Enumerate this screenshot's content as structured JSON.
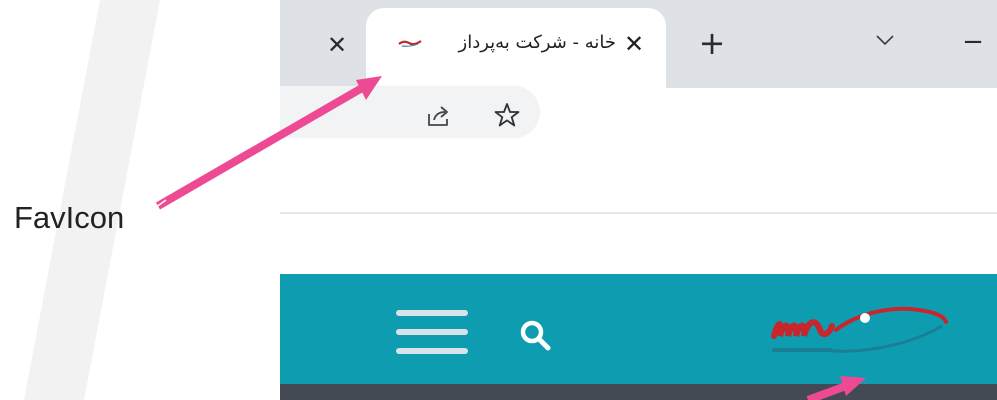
{
  "browser": {
    "prev_tab_close_glyph": "✕",
    "active_tab": {
      "title": "خانه - شرکت به‌پرداز",
      "favicon": "site-favicon",
      "close_glyph": "✕"
    },
    "new_tab_glyph": "+",
    "tab_search_icon": "chevron-down-icon",
    "minimize_glyph": "−",
    "toolbar": {
      "share_icon": "share-icon",
      "bookmark_icon": "star-icon"
    }
  },
  "website": {
    "header_color": "#0e9cb1",
    "menu_icon": "hamburger-menu-icon",
    "search_icon": "search-icon",
    "logo": "site-logo"
  },
  "annotation": {
    "label": "FavIcon",
    "arrow_color": "#ee4a93"
  }
}
